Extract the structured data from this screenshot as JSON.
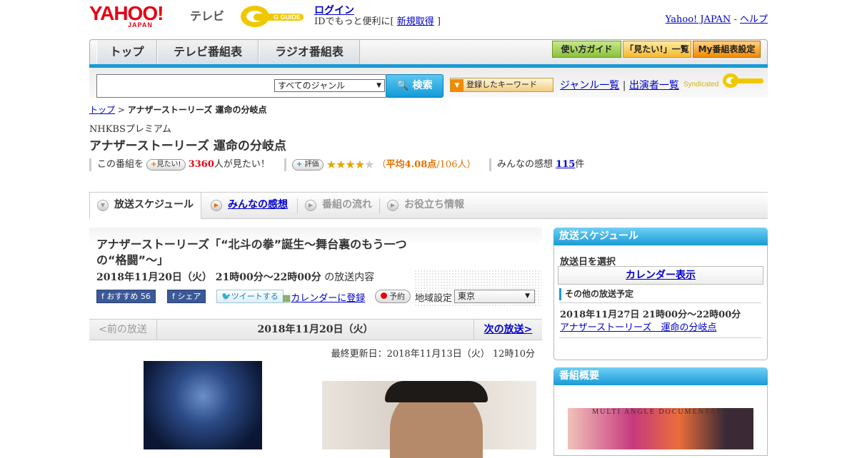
{
  "header": {
    "yahoo_logo": "YAHOO!",
    "yahoo_logo_sub": "JAPAN",
    "tv_label": "テレビ",
    "gguide_logo": "G GUIDE",
    "login": "ログイン",
    "login_sub_prefix": "IDでもっと便利に[",
    "signup": "新規取得",
    "login_sub_suffix": "]",
    "yahoo_japan_link": "Yahoo! JAPAN",
    "link_sep": "-",
    "help_link": "ヘルプ"
  },
  "nav": {
    "tabs": [
      "トップ",
      "テレビ番組表",
      "ラジオ番組表"
    ],
    "buttons": [
      "使い方ガイド",
      "「見たい!」一覧",
      "My番組表設定"
    ]
  },
  "search": {
    "genre": "すべてのジャンル",
    "button": "検索",
    "keyword_button": "登録したキーワード",
    "genre_list": "ジャンル一覧",
    "link_sep": "|",
    "cast_list": "出演者一覧",
    "syndicated": "Syndicated"
  },
  "breadcrumb": {
    "top": "トップ",
    "sep": ">",
    "current": "アナザーストーリーズ 運命の分岐点"
  },
  "program": {
    "channel": "NHKBSプレミアム",
    "title": "アナザーストーリーズ 運命の分岐点",
    "want_prefix": "この番組を",
    "want_button": "見たい!",
    "want_count": "3360",
    "want_suffix": "人が見たい！",
    "rate_button": "評価",
    "rating": 4.08,
    "rating_open": "（",
    "rating_avg": "平均4.08点",
    "rating_count": "/106人）",
    "impressions_prefix": "みんなの感想",
    "impressions_count": "115",
    "impressions_suffix": "件"
  },
  "tabs": [
    "放送スケジュール",
    "みんなの感想",
    "番組の流れ",
    "お役立ち情報"
  ],
  "episode": {
    "title": "アナザーストーリーズ「“北斗の拳”誕生～舞台裏のもう一つの“格闘”～」",
    "date": "2018年11月20日（火） 21時00分～22時00分",
    "date_suffix": "の放送内容",
    "fb_recommend": "おすすめ",
    "fb_count": "56",
    "fb_share": "シェア",
    "tweet": "ツイートする",
    "calendar_register": "カレンダーに登録",
    "reserve": "予約",
    "region_label": "地域設定",
    "region": "東京"
  },
  "pager": {
    "prev": "<前の放送",
    "date": "2018年11月20日（火）",
    "next": "次の放送>"
  },
  "updated": "最終更新日：2018年11月13日（火） 12時10分",
  "sidebar": {
    "schedule_title": "放送スケジュール",
    "select_date": "放送日を選択",
    "calendar": "カレンダー表示",
    "other_title": "その他の放送予定",
    "other_date": "2018年11月27日 21時00分～22時00分",
    "other_link": "アナザーストーリーズ　運命の分岐点",
    "overview_title": "番組概要",
    "overview_image_text": "MULTI ANGLE DOCUMENTARY"
  },
  "colors": {
    "accent": "#1a9ad6",
    "brand_red": "#e60012",
    "link": "#0000cc"
  }
}
